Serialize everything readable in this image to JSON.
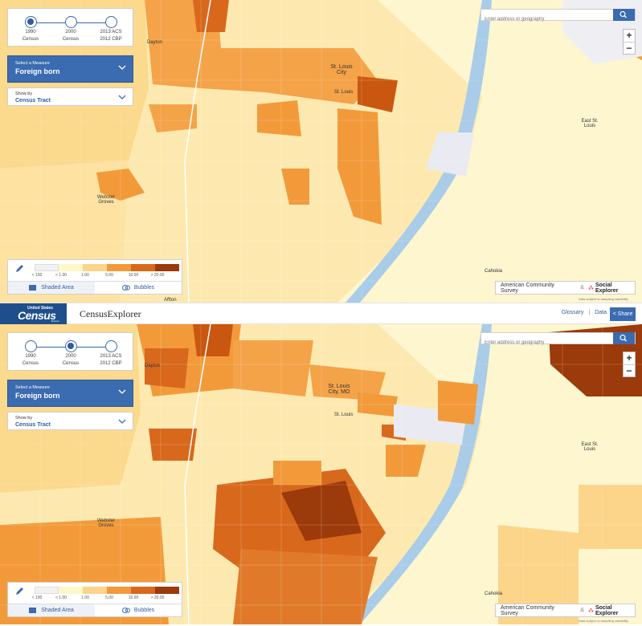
{
  "timeline": [
    {
      "year": "1990",
      "sub": "Census"
    },
    {
      "year": "2000",
      "sub": "Census"
    },
    {
      "year": "2013 ACS",
      "sub": "2012 CBP"
    }
  ],
  "panels": [
    {
      "active_step": 0
    },
    {
      "active_step": 1
    }
  ],
  "measure": {
    "caption": "Select a Measure",
    "value": "Foreign born"
  },
  "show_by": {
    "caption": "Show by",
    "value": "Census Tract"
  },
  "search": {
    "placeholder": "Enter address or geography"
  },
  "zoom": {
    "in": "+",
    "out": "−"
  },
  "legend": {
    "labels": [
      "< 100",
      "< 1.00",
      "1.00",
      "5.00",
      "10.00",
      "> 20.00"
    ],
    "colors": [
      "#f1f1f4",
      "#fdf8c8",
      "#fcd48a",
      "#f29a3a",
      "#d8681c",
      "#9b3a0a"
    ],
    "tab_shaded": "Shaded Area",
    "tab_bubbles": "Bubbles"
  },
  "attribution": {
    "survey": "American Community Survey",
    "amp": "&",
    "brand": "Social Explorer",
    "note": "Data subject to sampling variability"
  },
  "header": {
    "us": "United States",
    "census": "Census",
    "bureau": "Bureau",
    "title": "CensusExplorer",
    "glossary": "Glossary",
    "sep": "|",
    "data": "Data",
    "share": "Share"
  },
  "places": {
    "dayton": "Dayton",
    "st_louis_city": "St. Louis City",
    "st_louis_city_mo": "St. Louis City, MO",
    "st_louis": "St. Louis",
    "east_st_louis": "East St. Louis",
    "webster_groves": "Webster Groves",
    "cahokia": "Cahokia",
    "affton": "Affton"
  }
}
